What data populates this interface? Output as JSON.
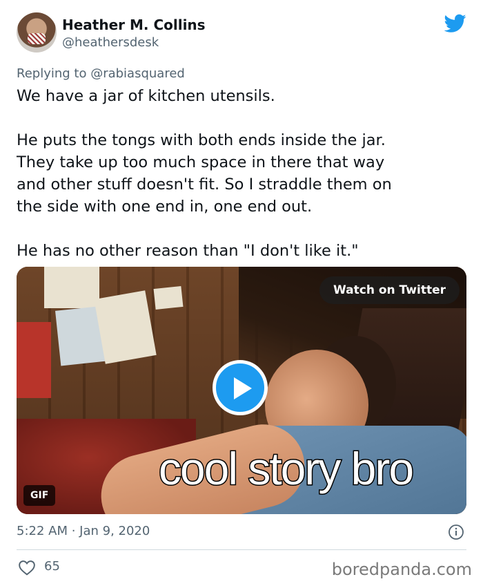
{
  "author": {
    "display_name": "Heather M. Collins",
    "handle": "@heathersdesk"
  },
  "reply": {
    "text": "Replying to @rabiasquared"
  },
  "tweet": {
    "lines": [
      "We have a jar of kitchen utensils.",
      "He puts the tongs with both ends inside the jar.",
      "They take up too much space in there that way",
      "and other stuff doesn't fit. So I straddle them on",
      "the side with one end in, one end out.",
      "He has no other reason than \"I don't like it.\""
    ]
  },
  "media": {
    "watch_label": "Watch on Twitter",
    "caption": "cool story bro",
    "badge": "GIF"
  },
  "meta": {
    "timestamp": "5:22 AM · Jan 9, 2020"
  },
  "actions": {
    "like_count": "65"
  },
  "watermark": "boredpanda.com",
  "colors": {
    "twitter_blue": "#1d9bf0",
    "secondary_text": "#536471"
  }
}
